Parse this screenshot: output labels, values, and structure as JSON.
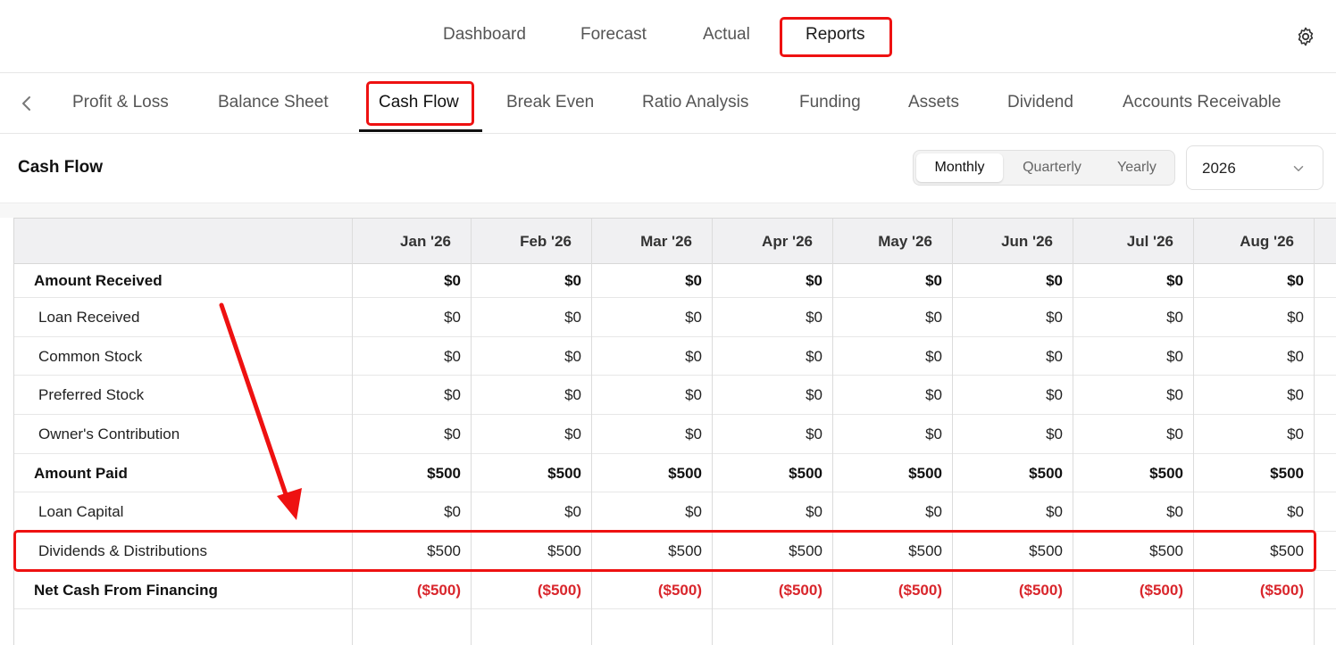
{
  "top_nav": {
    "items": [
      {
        "label": "Dashboard",
        "active": false
      },
      {
        "label": "Forecast",
        "active": false
      },
      {
        "label": "Actual",
        "active": false
      },
      {
        "label": "Reports",
        "active": true
      }
    ],
    "settings_icon": "gear-icon"
  },
  "sub_tabs": {
    "prev_icon": "chevron-left-icon",
    "items": [
      {
        "label": "Profit & Loss",
        "active": false
      },
      {
        "label": "Balance Sheet",
        "active": false
      },
      {
        "label": "Cash Flow",
        "active": true
      },
      {
        "label": "Break Even",
        "active": false
      },
      {
        "label": "Ratio Analysis",
        "active": false
      },
      {
        "label": "Funding",
        "active": false
      },
      {
        "label": "Assets",
        "active": false
      },
      {
        "label": "Dividend",
        "active": false
      },
      {
        "label": "Accounts Receivable",
        "active": false
      }
    ]
  },
  "section": {
    "title": "Cash Flow",
    "period_toggle": {
      "options": [
        "Monthly",
        "Quarterly",
        "Yearly"
      ],
      "selected": "Monthly"
    },
    "year_select": {
      "value": "2026",
      "icon": "chevron-down-icon"
    }
  },
  "table": {
    "columns": [
      "",
      "Jan '26",
      "Feb '26",
      "Mar '26",
      "Apr '26",
      "May '26",
      "Jun '26",
      "Jul '26",
      "Aug '26"
    ],
    "rows": [
      {
        "label": "Amount Received",
        "style": "bold",
        "values": [
          "$0",
          "$0",
          "$0",
          "$0",
          "$0",
          "$0",
          "$0",
          "$0"
        ]
      },
      {
        "label": "Loan Received",
        "style": "sub",
        "values": [
          "$0",
          "$0",
          "$0",
          "$0",
          "$0",
          "$0",
          "$0",
          "$0"
        ]
      },
      {
        "label": "Common Stock",
        "style": "sub",
        "values": [
          "$0",
          "$0",
          "$0",
          "$0",
          "$0",
          "$0",
          "$0",
          "$0"
        ]
      },
      {
        "label": "Preferred Stock",
        "style": "sub",
        "values": [
          "$0",
          "$0",
          "$0",
          "$0",
          "$0",
          "$0",
          "$0",
          "$0"
        ]
      },
      {
        "label": "Owner's Contribution",
        "style": "sub",
        "values": [
          "$0",
          "$0",
          "$0",
          "$0",
          "$0",
          "$0",
          "$0",
          "$0"
        ]
      },
      {
        "label": "Amount Paid",
        "style": "bold",
        "values": [
          "$500",
          "$500",
          "$500",
          "$500",
          "$500",
          "$500",
          "$500",
          "$500"
        ]
      },
      {
        "label": "Loan Capital",
        "style": "sub",
        "values": [
          "$0",
          "$0",
          "$0",
          "$0",
          "$0",
          "$0",
          "$0",
          "$0"
        ]
      },
      {
        "label": "Dividends & Distributions",
        "style": "sub",
        "values": [
          "$500",
          "$500",
          "$500",
          "$500",
          "$500",
          "$500",
          "$500",
          "$500"
        ]
      },
      {
        "label": "Net Cash From Financing",
        "style": "neg",
        "values": [
          "($500)",
          "($500)",
          "($500)",
          "($500)",
          "($500)",
          "($500)",
          "($500)",
          "($500)"
        ]
      }
    ]
  },
  "colors": {
    "accent_red": "#ee1111",
    "negative": "#d9262c"
  }
}
